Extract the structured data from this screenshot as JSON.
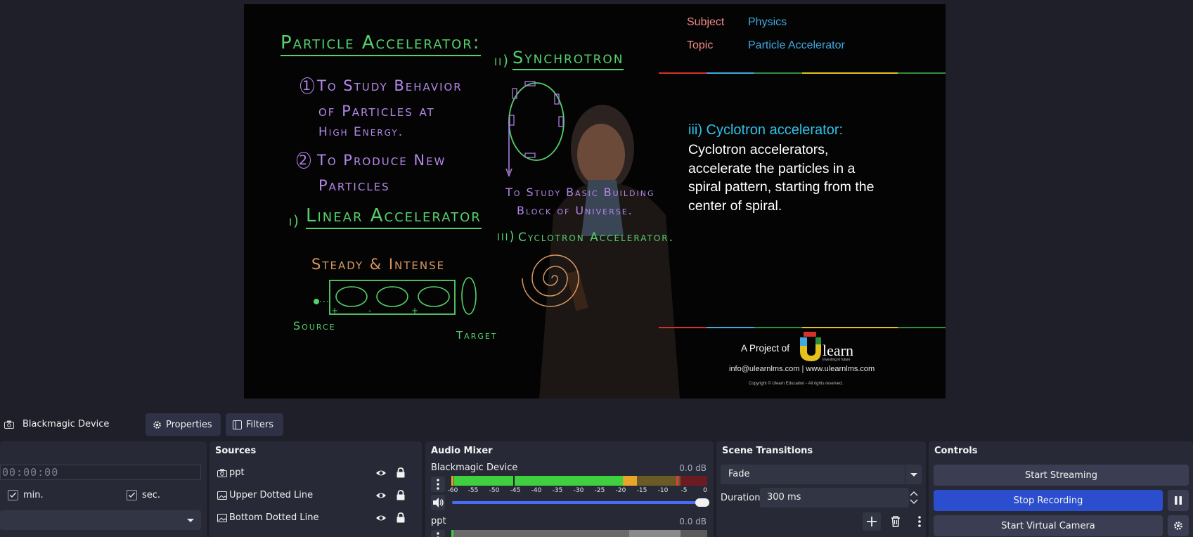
{
  "preview": {
    "board": {
      "title": "Particle Accelerator:",
      "left_items": [
        "To Study Behavior",
        "of Particles at",
        "High Energy.",
        "To Produce New",
        "Particles"
      ],
      "left_numbers": [
        "1",
        "2"
      ],
      "linear_heading": "Linear Accelerator",
      "linear_prefix": "i)",
      "linear_item": "Steady & Intense",
      "source_label": "Source",
      "target_label": "Target",
      "sync_heading": "Synchrotron",
      "sync_prefix": "ii)",
      "sync_item_line1": "To Study Basic Building",
      "sync_item_line2": "Block of Universe.",
      "cyclotron_heading": "Cyclotron Accelerator.",
      "cyclotron_prefix": "iii)",
      "plus_minus": [
        "+",
        "-",
        "+"
      ]
    },
    "slide": {
      "subject_key": "Subject",
      "subject_value": "Physics",
      "topic_key": "Topic",
      "topic_value": "Particle Accelerator",
      "heading": "iii) Cyclotron accelerator:",
      "body": "Cyclotron accelerators, accelerate the particles in a spiral pattern, starting from the center of spiral.",
      "project_prefix": "A Project of",
      "logo_text": "learn",
      "logo_tagline": "Investing in future",
      "contact": "info@ulearnlms.com | www.ulearnlms.com",
      "copyright": "Copyright © Ulearn Education - All rights reserved.",
      "stripe_colors": [
        "#d6312b",
        "#3fa9e0",
        "#2d8f3c",
        "#e3c21d",
        "#e3c21d",
        "#3fa9e0"
      ]
    }
  },
  "context_bar": {
    "source_name": "Blackmagic Device",
    "properties_label": "Properties",
    "filters_label": "Filters"
  },
  "scenes_dock": {
    "timer_value": "00:00:00",
    "min_label": "min.",
    "sec_label": "sec."
  },
  "sources_dock": {
    "title": "Sources",
    "items": [
      {
        "label": "ppt",
        "icon": "camera-icon"
      },
      {
        "label": "Upper Dotted Line",
        "icon": "image-icon"
      },
      {
        "label": "Bottom Dotted Line",
        "icon": "image-icon"
      }
    ]
  },
  "mixer_dock": {
    "title": "Audio Mixer",
    "channels": [
      {
        "name": "Blackmagic Device",
        "db": "0.0 dB",
        "level": 0.67
      },
      {
        "name": "ppt",
        "db": "0.0 dB",
        "level": 0.0
      }
    ],
    "ticks": [
      "-60",
      "-55",
      "-50",
      "-45",
      "-40",
      "-35",
      "-30",
      "-25",
      "-20",
      "-15",
      "-10",
      "-5",
      "0"
    ]
  },
  "transitions_dock": {
    "title": "Scene Transitions",
    "selected": "Fade",
    "duration_label": "Duration",
    "duration_value": "300 ms"
  },
  "controls_dock": {
    "title": "Controls",
    "start_streaming": "Start Streaming",
    "stop_recording": "Stop Recording",
    "start_virtual_camera": "Start Virtual Camera"
  },
  "colors": {
    "accent_blue": "#2b4ecf",
    "meter_green": "#3fcf3f",
    "meter_yellow": "#e8a52a",
    "meter_red": "#c3262f"
  }
}
